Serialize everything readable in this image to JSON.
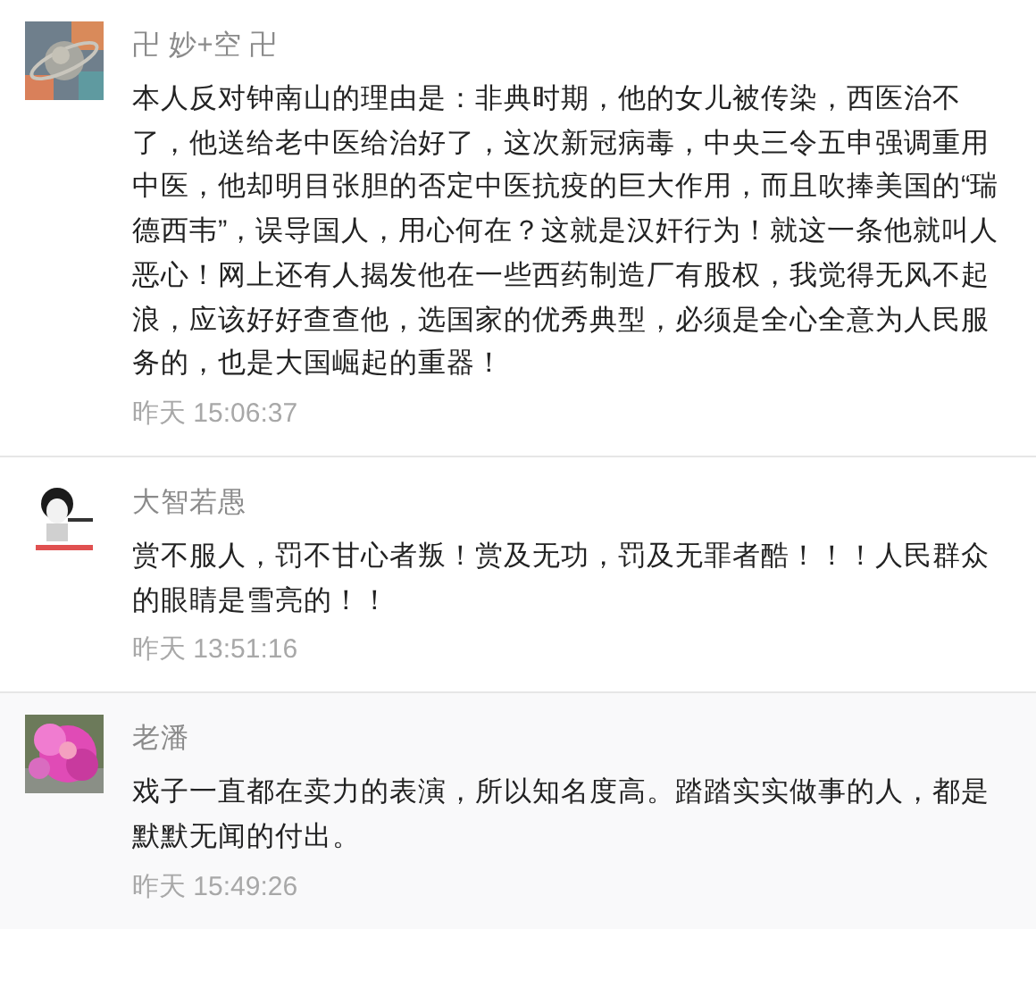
{
  "comments": [
    {
      "name": "卍 妙+空 卍",
      "text": "本人反对钟南山的理由是：非典时期，他的女儿被传染，西医治不了，他送给老中医给治好了，这次新冠病毒，中央三令五申强调重用中医，他却明目张胆的否定中医抗疫的巨大作用，而且吹捧美国的“瑞德西韦”，误导国人，用心何在？这就是汉奸行为！就这一条他就叫人恶心！网上还有人揭发他在一些西药制造厂有股权，我觉得无风不起浪，应该好好查查他，选国家的优秀典型，必须是全心全意为人民服务的，也是大国崛起的重器！",
      "time": "昨天 15:06:37"
    },
    {
      "name": "大智若愚",
      "text": "赏不服人，罚不甘心者叛！赏及无功，罚及无罪者酷！！！人民群众的眼睛是雪亮的！！",
      "time": "昨天 13:51:16"
    },
    {
      "name": "老潘",
      "text": "戏子一直都在卖力的表演，所以知名度高。踏踏实实做事的人，都是默默无闻的付出。",
      "time": "昨天 15:49:26"
    }
  ]
}
